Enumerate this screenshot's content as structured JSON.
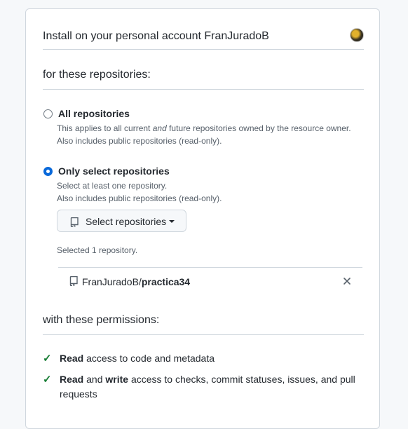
{
  "header": {
    "title": "Install on your personal account FranJuradoB"
  },
  "repositories_section": {
    "title": "for these repositories:",
    "options": [
      {
        "label": "All repositories",
        "selected": false,
        "description_prefix": "This applies to all current ",
        "description_emphasis": "and",
        "description_suffix": " future repositories owned by the resource owner.",
        "note": "Also includes public repositories (read-only)."
      },
      {
        "label": "Only select repositories",
        "selected": true,
        "description": "Select at least one repository.",
        "note": "Also includes public repositories (read-only)."
      }
    ],
    "select_button_label": "Select repositories",
    "selected_count_text": "Selected 1 repository.",
    "selected_repos": [
      {
        "owner": "FranJuradoB/",
        "name": "practica34"
      }
    ]
  },
  "permissions_section": {
    "title": "with these permissions:",
    "permissions": [
      {
        "bold1": "Read",
        "text": " access to code and metadata"
      },
      {
        "bold1": "Read",
        "mid": " and ",
        "bold2": "write",
        "text": " access to checks, commit statuses, issues, and pull requests"
      }
    ]
  },
  "colors": {
    "accent": "#0969da",
    "check": "#1a7f37",
    "border": "#d0d7de",
    "muted_text": "#57606a"
  },
  "icons": [
    "repo-icon",
    "check-icon",
    "close-icon",
    "caret-down-icon",
    "avatar"
  ]
}
